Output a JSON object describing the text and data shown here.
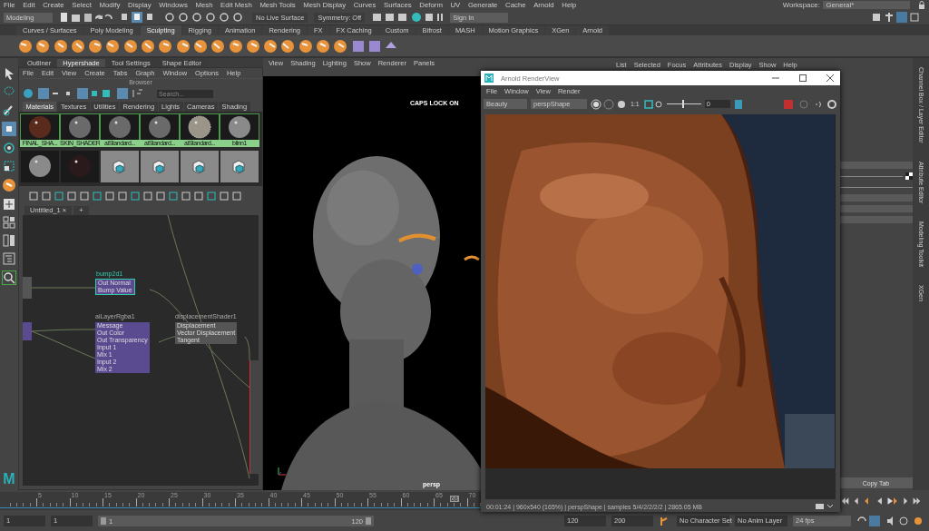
{
  "menu_bar": {
    "items": [
      "File",
      "Edit",
      "Create",
      "Select",
      "Modify",
      "Display",
      "Windows",
      "Mesh",
      "Edit Mesh",
      "Mesh Tools",
      "Mesh Display",
      "Curves",
      "Surfaces",
      "Deform",
      "UV",
      "Generate",
      "Cache",
      "Arnold",
      "Help"
    ],
    "workspace_label": "Workspace:",
    "workspace": "General*"
  },
  "status_line": {
    "mode": "Modeling",
    "live_surface": "No Live Surface",
    "symmetry": "Symmetry: Off",
    "sign_in": "Sign In"
  },
  "shelf": {
    "tabs": [
      {
        "label": "Curves / Surfaces",
        "selected": false
      },
      {
        "label": "Poly Modeling",
        "selected": false
      },
      {
        "label": "Sculpting",
        "selected": true
      },
      {
        "label": "Rigging",
        "selected": false
      },
      {
        "label": "Animation",
        "selected": false
      },
      {
        "label": "Rendering",
        "selected": false
      },
      {
        "label": "FX",
        "selected": false
      },
      {
        "label": "FX Caching",
        "selected": false
      },
      {
        "label": "Custom",
        "selected": false
      },
      {
        "label": "Bifrost",
        "selected": false
      },
      {
        "label": "MASH",
        "selected": false
      },
      {
        "label": "Motion Graphics",
        "selected": false
      },
      {
        "label": "XGen",
        "selected": false
      },
      {
        "label": "Arnold",
        "selected": false
      }
    ]
  },
  "app_logo": "M",
  "hypershade": {
    "panel_tabs": [
      {
        "label": "Outliner",
        "selected": false
      },
      {
        "label": "Hypershade",
        "selected": true
      },
      {
        "label": "Tool Settings",
        "selected": false
      },
      {
        "label": "Shape Editor",
        "selected": false
      }
    ],
    "menu": [
      "File",
      "Edit",
      "View",
      "Create",
      "Tabs",
      "Graph",
      "Window",
      "Options",
      "Help"
    ],
    "browser_title": "Browser",
    "search": {
      "placeholder": "Search..."
    },
    "tabs": [
      {
        "label": "Materials",
        "selected": true
      },
      {
        "label": "Textures",
        "selected": false
      },
      {
        "label": "Utilities",
        "selected": false
      },
      {
        "label": "Rendering",
        "selected": false
      },
      {
        "label": "Lights",
        "selected": false
      },
      {
        "label": "Cameras",
        "selected": false
      },
      {
        "label": "Shading",
        "selected": false
      }
    ],
    "swatches": [
      {
        "label": "FINAL_SHA...",
        "kind": "leather",
        "selected": true
      },
      {
        "label": "SKIN_SHADER",
        "kind": "plain",
        "selected": true
      },
      {
        "label": "aiStandard...",
        "kind": "plain",
        "selected": true
      },
      {
        "label": "aiStandard...",
        "kind": "plain",
        "selected": true
      },
      {
        "label": "aiStandard...",
        "kind": "rock",
        "selected": true
      },
      {
        "label": "blinn1",
        "kind": "bright",
        "selected": true
      },
      {
        "kind": "bright",
        "selected": false
      },
      {
        "kind": "glass",
        "selected": false
      },
      {
        "kind": "node",
        "selected": false
      },
      {
        "kind": "node",
        "selected": false
      },
      {
        "kind": "node",
        "selected": false
      },
      {
        "kind": "node",
        "selected": false
      }
    ],
    "graph_tab": "Untitled_1",
    "graph_tab_close": "×",
    "graph_add": "+",
    "nodes": [
      {
        "title": "bump2d1",
        "ports": [
          "Out Normal",
          "Bump Value"
        ]
      },
      {
        "title": "aiLayerRgba1",
        "ports": [
          "Message",
          "Out Color",
          "Out Transparency",
          "Input 1",
          "Mix 1",
          "Input 2",
          "Mix 2"
        ]
      },
      {
        "title": "displacementShader1",
        "ports": [
          "Displacement",
          "Vector Displacement",
          "Tangent"
        ]
      }
    ]
  },
  "viewport": {
    "menu": [
      "View",
      "Shading",
      "Lighting",
      "Show",
      "Renderer",
      "Panels"
    ],
    "caps_lock": "CAPS LOCK ON",
    "camera": "persp"
  },
  "channel_box": {
    "menu": [
      "List",
      "Selected",
      "Focus",
      "Attributes",
      "Display",
      "Show",
      "Help"
    ],
    "side_tabs": [
      "Channel Box / Layer Editor",
      "Attribute Editor",
      "Modeling Toolkit",
      "XGen"
    ],
    "copy_tab": "Copy Tab"
  },
  "render_view": {
    "title": "Arnold RenderView",
    "menu": [
      "File",
      "Window",
      "View",
      "Render"
    ],
    "aov": "Beauty",
    "camera": "perspShape",
    "ratio": "1:1",
    "exposure": "0",
    "exposure_slider": {
      "level": 0.45
    },
    "status": "00:01:24 | 960x540 (165%) | perspShape  | samples 5/4/2/2/2/2 | 2865.05 MB"
  },
  "timeline": {
    "level": 0.943,
    "ticks": [
      "5",
      "10",
      "15",
      "20",
      "25",
      "30",
      "35",
      "40",
      "45",
      "50",
      "55",
      "60",
      "65",
      "70"
    ],
    "current": "68"
  },
  "range": {
    "level": 1,
    "start": "1",
    "playback_start": "1",
    "slider_start": "1",
    "slider_end": "120",
    "playback_end": "120",
    "end": "200",
    "character_set": "No Character Set",
    "anim_layer": "No Anim Layer",
    "fps": "24 fps"
  }
}
